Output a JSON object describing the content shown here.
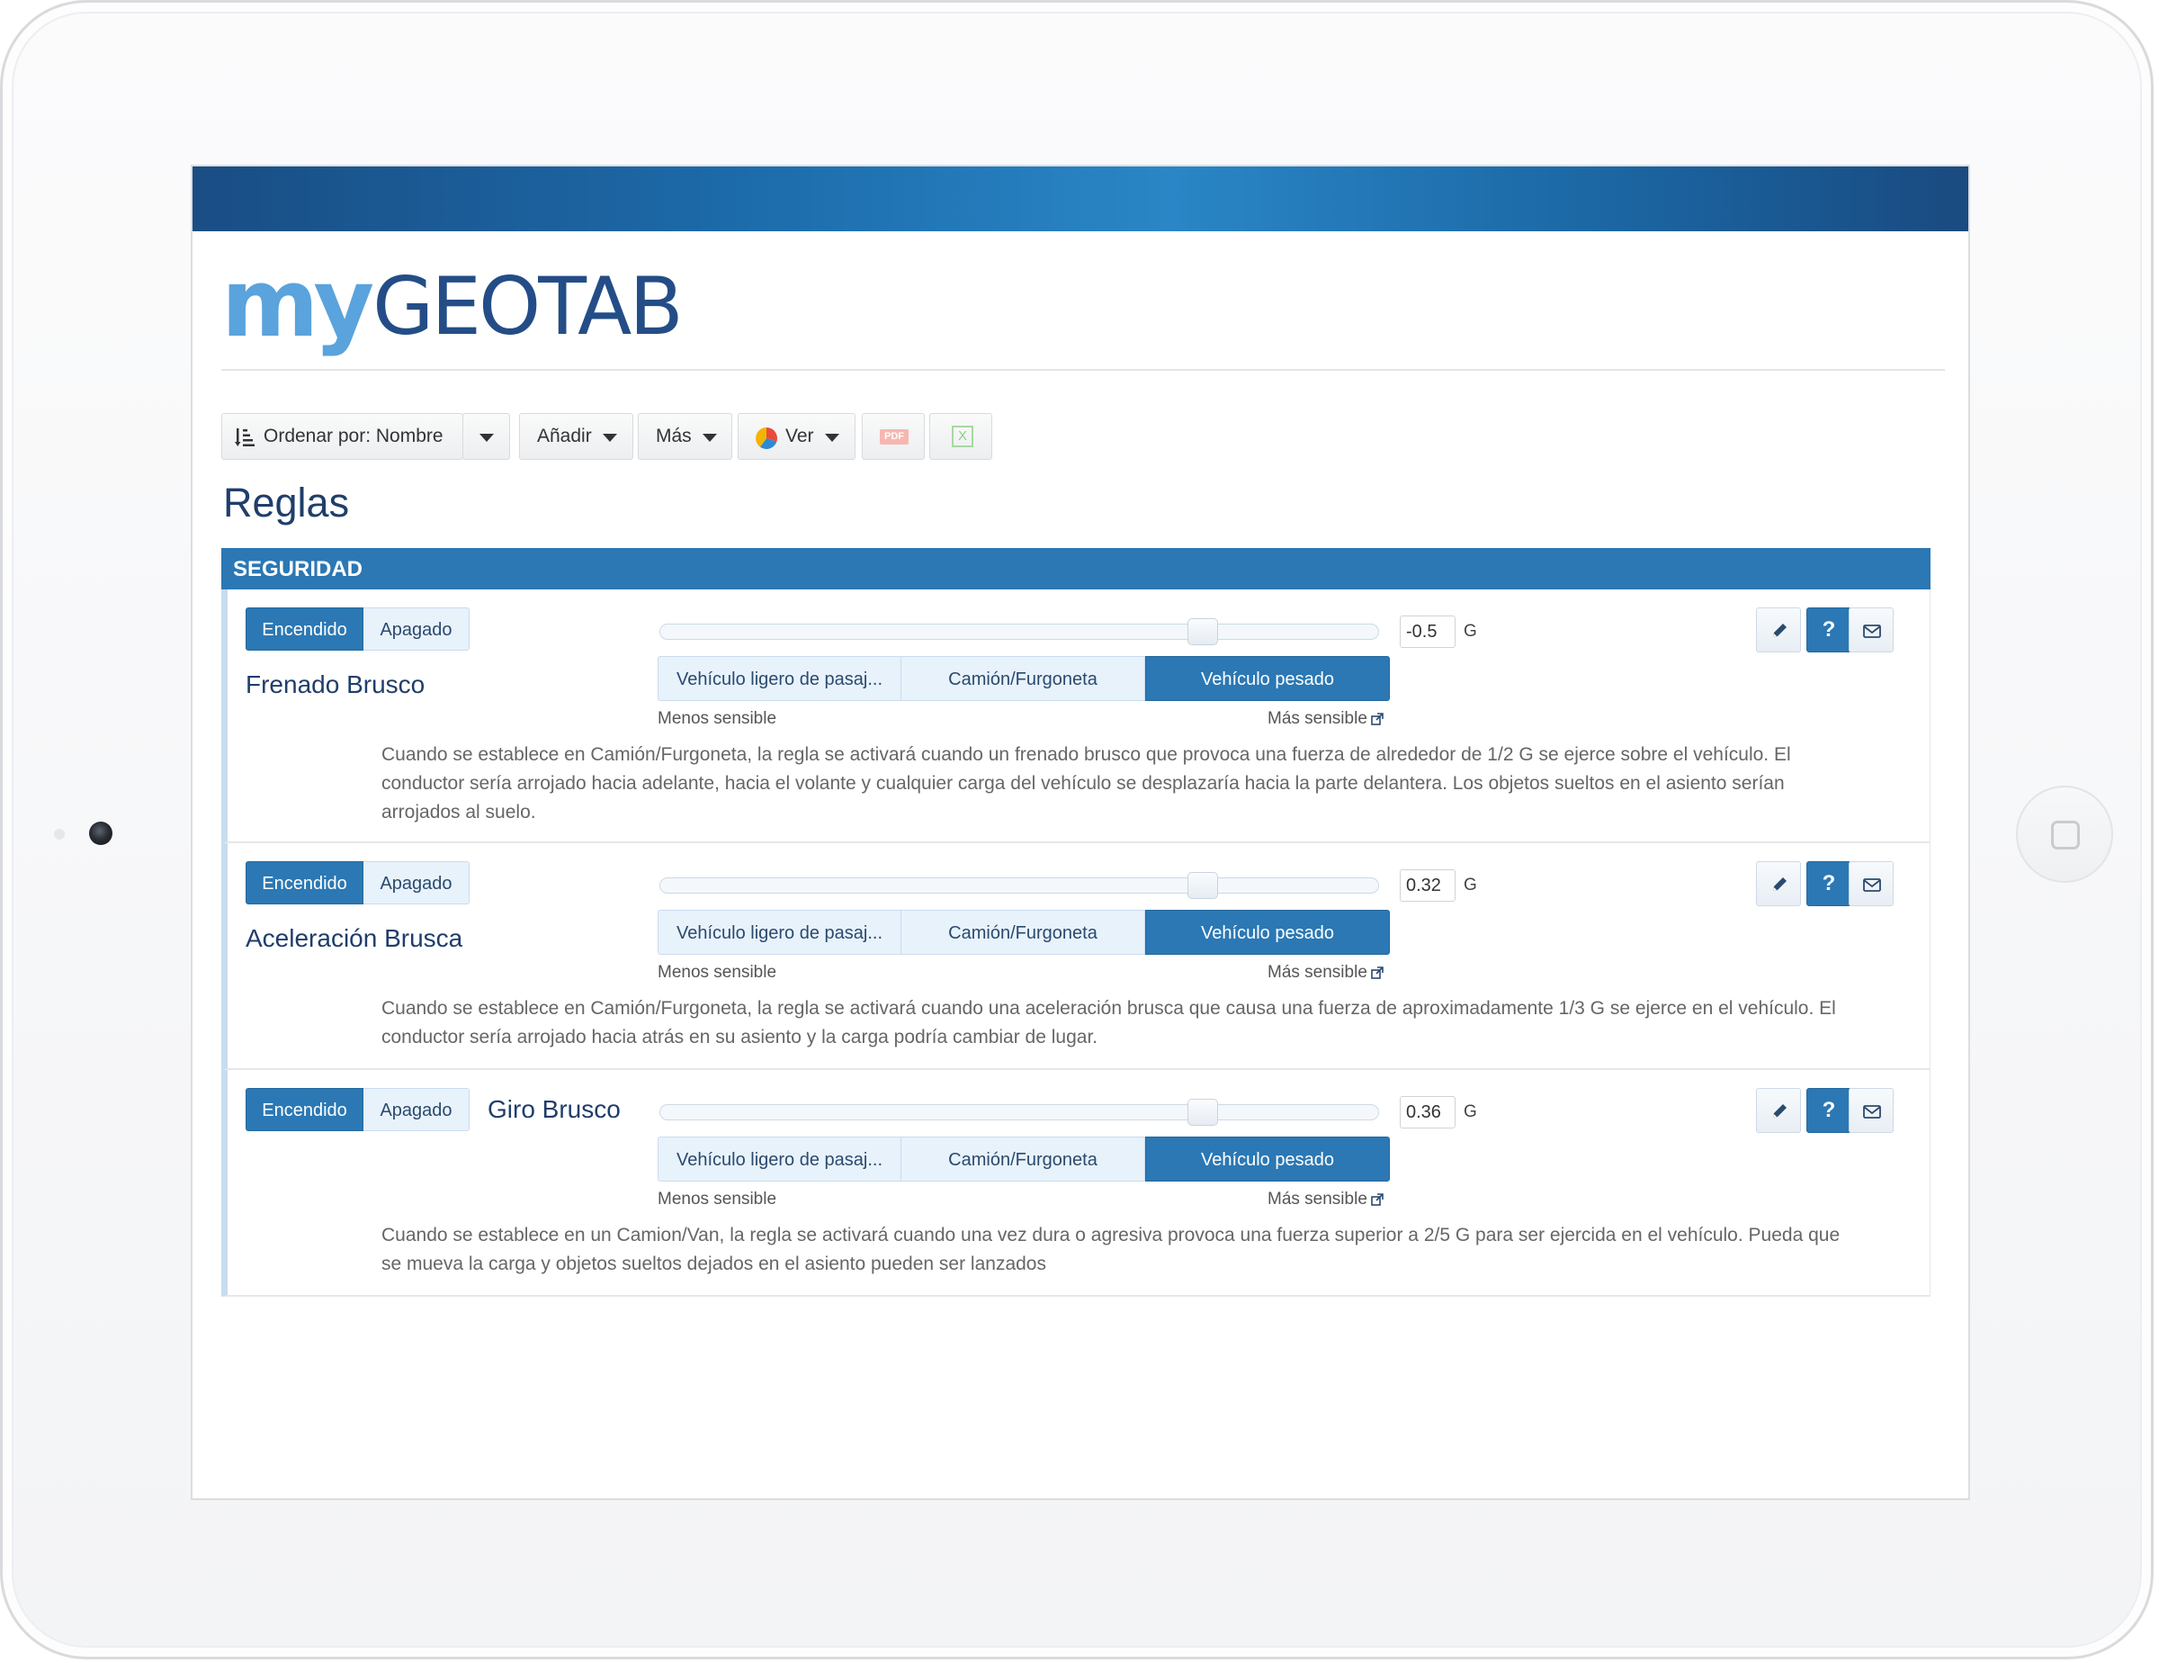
{
  "app": {
    "logo_my": "my",
    "logo_geotab": "GEOTAB",
    "brand_color": "#2b78b4"
  },
  "toolbar": {
    "sort_label": "Ordenar por: Nombre",
    "add_label": "Añadir",
    "more_label": "Más",
    "view_label": "Ver",
    "pdf_label": "PDF",
    "excel_label": "X"
  },
  "page": {
    "title": "Reglas"
  },
  "section": {
    "title": "SEGURIDAD"
  },
  "labels": {
    "on": "Encendido",
    "off": "Apagado",
    "unit": "G",
    "less_sensitive": "Menos sensible",
    "more_sensitive": "Más sensible",
    "vehicle_light": "Vehículo ligero de pasaj...",
    "vehicle_van": "Camión/Furgoneta",
    "vehicle_heavy": "Vehículo pesado",
    "help_icon": "?"
  },
  "rules": [
    {
      "name": "Frenado Brusco",
      "value": "-0.5",
      "slider_position": 0.75,
      "state": "Encendido",
      "selected_vehicle": "Vehículo pesado",
      "description": "Cuando se establece en Camión/Furgoneta, la regla se activará cuando un frenado brusco que provoca una fuerza de alrededor de 1/2 G se ejerce sobre el vehículo. El conductor sería arrojado hacia adelante, hacia el volante y cualquier carga del vehículo se desplazaría hacia la parte delantera. Los objetos sueltos en el asiento serían arrojados al suelo."
    },
    {
      "name": "Aceleración Brusca",
      "value": "0.32",
      "slider_position": 0.75,
      "state": "Encendido",
      "selected_vehicle": "Vehículo pesado",
      "description": "Cuando se establece en Camión/Furgoneta, la regla se activará cuando una aceleración brusca que causa una fuerza de aproximadamente 1/3 G se ejerce en el vehículo. El conductor sería arrojado hacia atrás en su asiento y la carga podría cambiar de lugar."
    },
    {
      "name": "Giro Brusco",
      "value": "0.36",
      "slider_position": 0.75,
      "state": "Encendido",
      "selected_vehicle": "Vehículo pesado",
      "description": "Cuando se establece en un Camion/Van, la regla se activará cuando una vez dura o agresiva provoca una fuerza superior a 2/5 G para ser ejercida en el vehículo. Pueda que se mueva la carga y objetos sueltos dejados en el asiento pueden ser lanzados"
    }
  ]
}
